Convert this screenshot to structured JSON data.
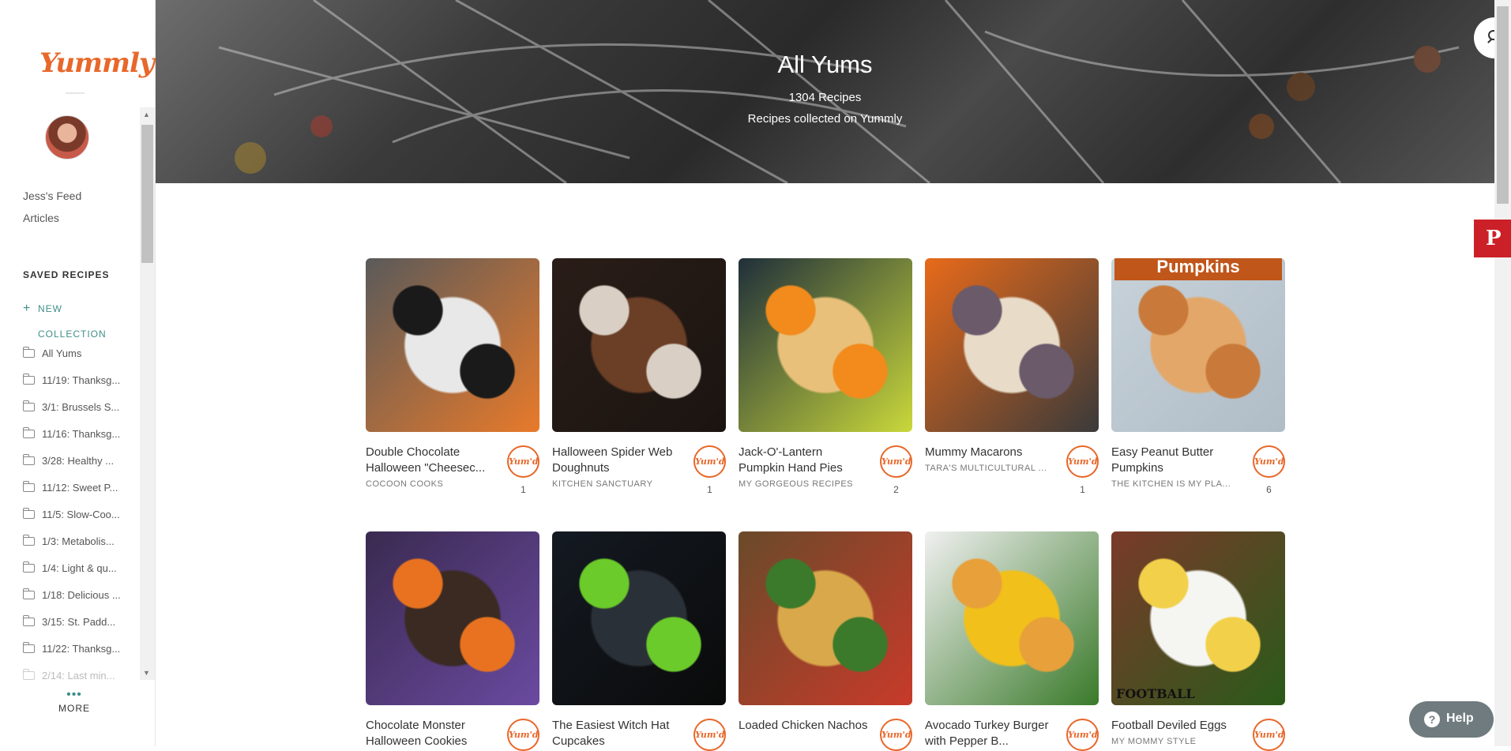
{
  "sidebar": {
    "logo": "Yummly",
    "links": [
      "Jess's Feed",
      "Articles"
    ],
    "saved_title": "SAVED RECIPES",
    "new_collection_plus": "+",
    "new_collection": "NEW COLLECTION",
    "collections": [
      "All Yums",
      "11/19: Thanksg...",
      "3/1: Brussels S...",
      "11/16: Thanksg...",
      "3/28: Healthy ...",
      "11/12: Sweet P...",
      "11/5: Slow-Coo...",
      "1/3: Metabolis...",
      "1/4: Light & qu...",
      "1/18: Delicious ...",
      "3/15: St. Padd...",
      "11/22: Thanksg...",
      "2/14: Last min..."
    ],
    "more_dots": "•••",
    "more": "MORE"
  },
  "hero": {
    "title": "All Yums",
    "count": "1304 Recipes",
    "subtitle": "Recipes collected on Yummly"
  },
  "pinterest_glyph": "P",
  "yum_label": "Yum'd",
  "recipes": [
    {
      "title": "Double Chocolate Halloween \"Cheesec...",
      "source": "COCOON COOKS",
      "count": "1",
      "colors": [
        "#5a5a5a",
        "#e8e8e8",
        "#1a1a1a",
        "#e87a2a"
      ]
    },
    {
      "title": "Halloween Spider Web Doughnuts",
      "source": "KITCHEN SANCTUARY",
      "count": "1",
      "colors": [
        "#2a1d18",
        "#6b3f26",
        "#d9cfc4",
        "#1a1410"
      ]
    },
    {
      "title": "Jack-O'-Lantern Pumpkin Hand Pies",
      "source": "MY GORGEOUS RECIPES",
      "count": "2",
      "colors": [
        "#1f2f3a",
        "#e8c07a",
        "#f28a1c",
        "#c9d83a"
      ]
    },
    {
      "title": "Mummy Macarons",
      "source": "TARA'S MULTICULTURAL ...",
      "count": "1",
      "colors": [
        "#e86a1a",
        "#e8dcc8",
        "#6a5a6a",
        "#3a3a3a"
      ]
    },
    {
      "title": "Easy Peanut Butter Pumpkins",
      "source": "THE KITCHEN IS MY PLA...",
      "count": "6",
      "colors": [
        "#c7d2da",
        "#e3a769",
        "#c97a3a",
        "#b0bcc6"
      ]
    },
    {
      "title": "Chocolate Monster Halloween Cookies",
      "source": "",
      "count": "",
      "colors": [
        "#3a2a50",
        "#3a2a22",
        "#e8721f",
        "#6a4aa0"
      ]
    },
    {
      "title": "The Easiest Witch Hat Cupcakes",
      "source": "",
      "count": "",
      "colors": [
        "#141a22",
        "#2a3038",
        "#6acb2a",
        "#0a0a0a"
      ]
    },
    {
      "title": "Loaded Chicken Nachos",
      "source": "",
      "count": "",
      "colors": [
        "#6a4a2a",
        "#d9a84a",
        "#3a7a2a",
        "#c83a2a"
      ]
    },
    {
      "title": "Avocado Turkey Burger with Pepper B...",
      "source": "",
      "count": "",
      "colors": [
        "#f0f0f0",
        "#f2c01a",
        "#e8a03a",
        "#3a7a2a"
      ]
    },
    {
      "title": "Football Deviled Eggs",
      "source": "MY MOMMY STYLE",
      "count": "",
      "colors": [
        "#7a3a2a",
        "#f5f5f2",
        "#f2d04a",
        "#2a5a1a"
      ]
    }
  ],
  "overlay_texts": {
    "pumpkins_banner": "Pumpkins",
    "football_label": "FOOTBALL"
  },
  "help": {
    "icon": "?",
    "label": "Help"
  }
}
